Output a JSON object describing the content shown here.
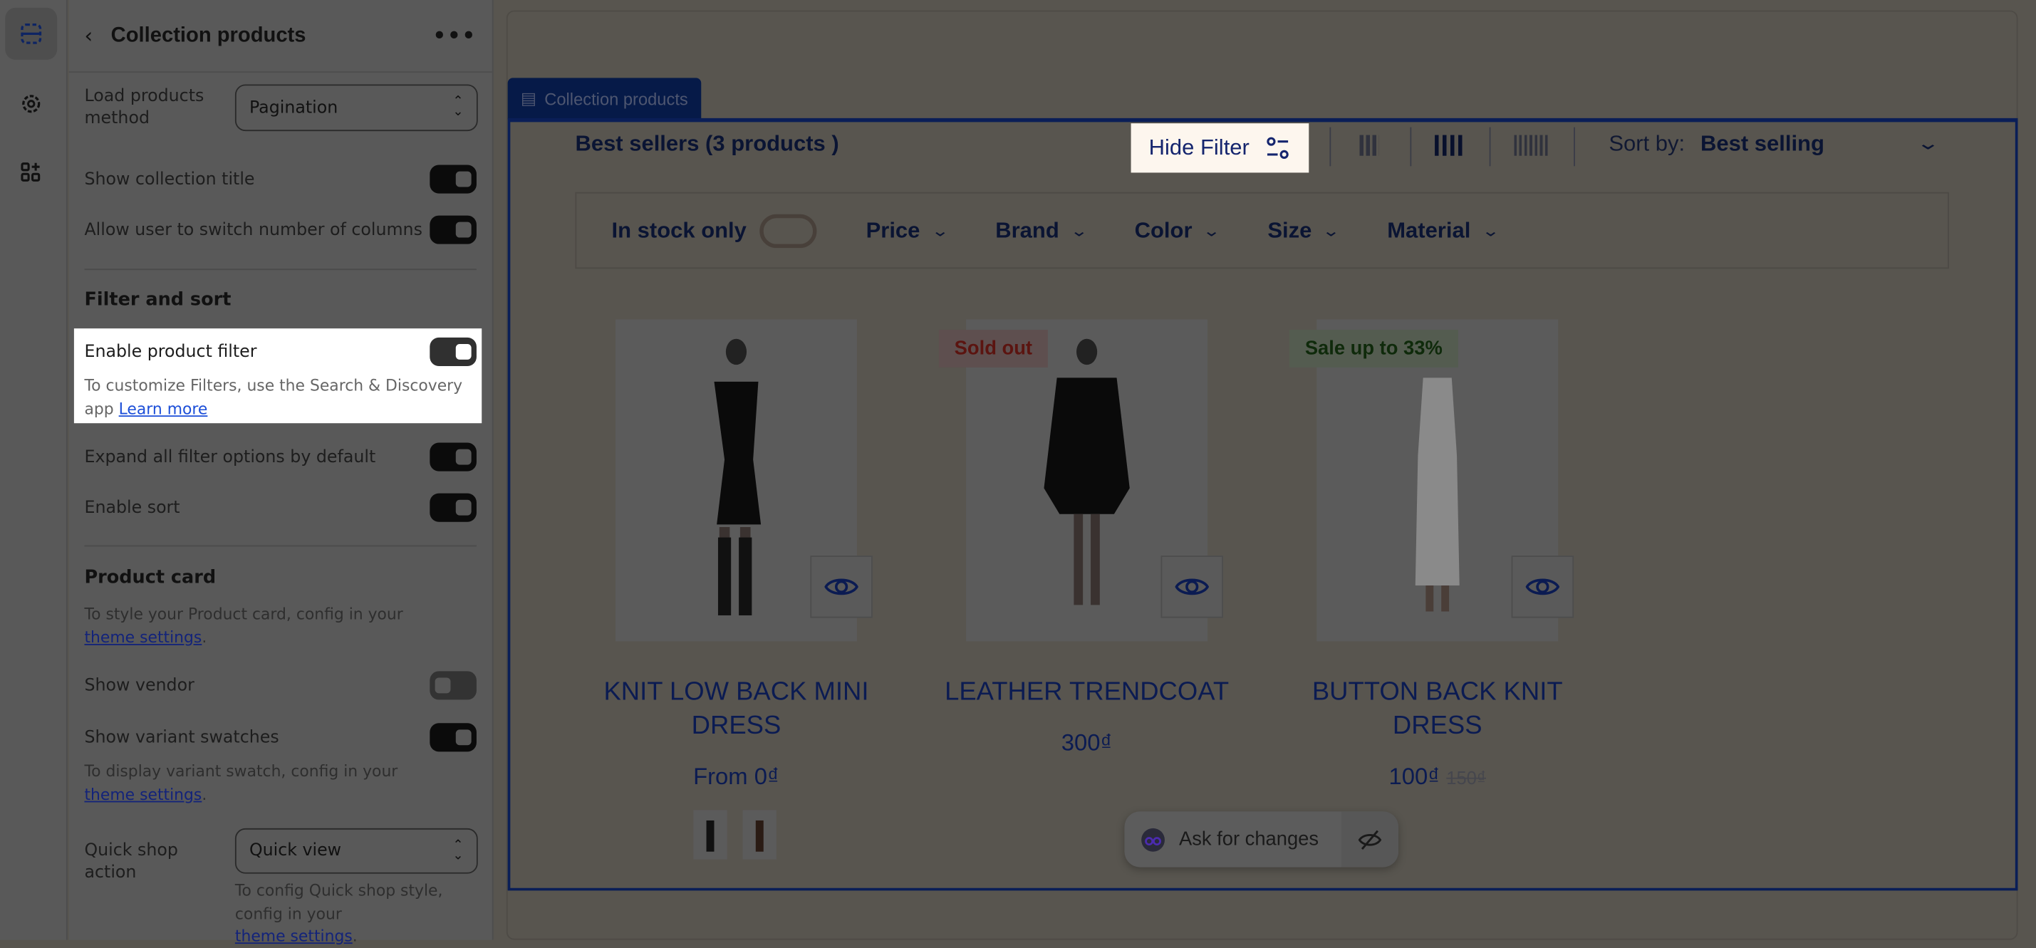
{
  "rail": {
    "icons": [
      "sections-icon",
      "settings-icon",
      "apps-add-icon"
    ]
  },
  "panel": {
    "title": "Collection products",
    "load_method": {
      "label": "Load products method",
      "value": "Pagination"
    },
    "show_collection_title": {
      "label": "Show collection title",
      "on": true
    },
    "switch_columns": {
      "label": "Allow user to switch number of columns",
      "on": true
    },
    "filter_heading": "Filter and sort",
    "enable_filter": {
      "label": "Enable product filter",
      "on": true,
      "hint": "To customize Filters, use the Search & Discovery app",
      "link": "Learn more"
    },
    "expand_filters": {
      "label": "Expand all filter options by default",
      "on": true
    },
    "enable_sort": {
      "label": "Enable sort",
      "on": true
    },
    "card_heading": "Product card",
    "card_hint": "To style your Product card, config in your",
    "card_link": "theme settings",
    "show_vendor": {
      "label": "Show vendor",
      "on": false
    },
    "show_swatches": {
      "label": "Show variant swatches",
      "on": true
    },
    "swatch_hint": "To display variant swatch, config in your",
    "swatch_link": "theme settings",
    "quick_shop": {
      "label": "Quick shop action",
      "value": "Quick view",
      "hint": "To config Quick shop style, config in your",
      "link": "theme settings"
    }
  },
  "preview": {
    "section_tag": "Collection products",
    "heading": "Best sellers (3 products )",
    "hide_filter": "Hide Filter",
    "sort_label": "Sort by:",
    "sort_value": "Best selling",
    "filters": [
      "In stock only",
      "Price",
      "Brand",
      "Color",
      "Size",
      "Material"
    ],
    "products": [
      {
        "name": "KNIT LOW BACK MINI DRESS",
        "price": "From 0₫",
        "badge": ""
      },
      {
        "name": "LEATHER TRENDCOAT",
        "price": "300₫",
        "badge": "Sold out"
      },
      {
        "name": "BUTTON BACK KNIT DRESS",
        "price": "100₫",
        "compare_price": "150₫",
        "badge": "Sale up to 33%"
      }
    ],
    "ask": "Ask for changes"
  }
}
